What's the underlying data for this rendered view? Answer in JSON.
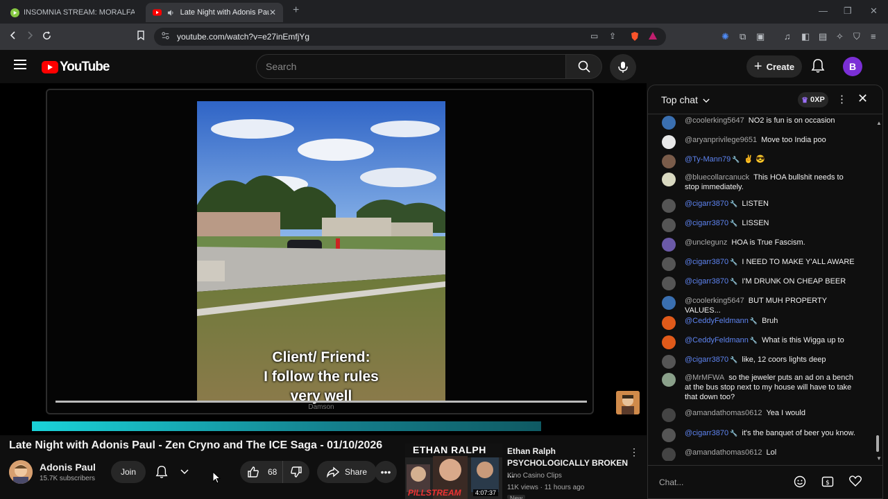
{
  "browser": {
    "tabs": [
      {
        "label": "INSOMNIA STREAM: MORALFAG ED",
        "active": false
      },
      {
        "label": "Late Night with Adonis Paul -",
        "active": true
      }
    ],
    "url": "youtube.com/watch?v=e27inEmfjYg"
  },
  "header": {
    "logo_text": "YouTube",
    "search_placeholder": "Search",
    "create_label": "Create",
    "avatar_letter": "B"
  },
  "player": {
    "caption_line1": "Client/ Friend:",
    "caption_line2": "I follow the rules",
    "caption_line3": "very well",
    "watermark": "Damson",
    "progress": 0.79
  },
  "video": {
    "title": "Late Night with Adonis Paul - Zen Cryno and The ICE Saga - 01/10/2026",
    "channel": "Adonis Paul",
    "subscribers": "15.7K subscribers",
    "join_label": "Join",
    "likes": "68",
    "share_label": "Share"
  },
  "recommended": {
    "thumb_text_top": "ETHAN RALPH",
    "thumb_text_bottom": "PILLSTREAM",
    "channel_title": "Ethan Ralph",
    "title": "PSYCHOLOGICALLY BROKEN ...",
    "channel": "Kino Casino Clips",
    "meta": "11K views · 11 hours ago",
    "duration": "4:07:37",
    "badge": "New"
  },
  "chat": {
    "mode": "Top chat",
    "xp": "0XP",
    "input_placeholder": "Chat...",
    "messages": [
      {
        "author": "@coolerking5647",
        "text": "NO2 is fun is on occasion",
        "mod": false,
        "color": "#3a6fb0"
      },
      {
        "author": "@aryanprivilege9651",
        "text": "Move too India poo",
        "mod": false,
        "color": "#e8e8e8"
      },
      {
        "author": "@Ty-Mann79",
        "text": "✌️ 😎",
        "mod": true,
        "color": "#7a5c4a"
      },
      {
        "author": "@bluecollarcanuck",
        "text": "This HOA bullshit needs to stop immediately.",
        "mod": false,
        "color": "#d8d8c0"
      },
      {
        "author": "@cigarr3870",
        "text": "LISTEN",
        "mod": true,
        "color": "#555"
      },
      {
        "author": "@cigarr3870",
        "text": "LISSEN",
        "mod": true,
        "color": "#555"
      },
      {
        "author": "@unclegunz",
        "text": "HOA is True Fascism.",
        "mod": false,
        "color": "#6b5aa8"
      },
      {
        "author": "@cigarr3870",
        "text": "I NEED TO MAKE Y'ALL AWARE",
        "mod": true,
        "color": "#555"
      },
      {
        "author": "@cigarr3870",
        "text": "I'M DRUNK ON CHEAP BEER",
        "mod": true,
        "color": "#555"
      },
      {
        "author": "@coolerking5647",
        "text": "BUT MUH PROPERTY VALUES...",
        "mod": false,
        "color": "#3a6fb0"
      },
      {
        "author": "@CeddyFeldmann",
        "text": "Bruh",
        "mod": true,
        "color": "#e05a1a"
      },
      {
        "author": "@CeddyFeldmann",
        "text": "What is this Wigga up to",
        "mod": true,
        "color": "#e05a1a"
      },
      {
        "author": "@cigarr3870",
        "text": "like, 12 coors lights deep",
        "mod": true,
        "color": "#555"
      },
      {
        "author": "@MrMFWA",
        "text": "so the jeweler puts an ad on a bench at the bus stop next to my house will have to take that down too?",
        "mod": false,
        "color": "#8aa08a"
      },
      {
        "author": "@amandathomas0612",
        "text": "Yea I would",
        "mod": false,
        "color": "#444"
      },
      {
        "author": "@cigarr3870",
        "text": "it's the banquet of beer you know.",
        "mod": true,
        "color": "#555"
      },
      {
        "author": "@amandathomas0612",
        "text": "Lol",
        "mod": false,
        "color": "#444"
      }
    ]
  }
}
